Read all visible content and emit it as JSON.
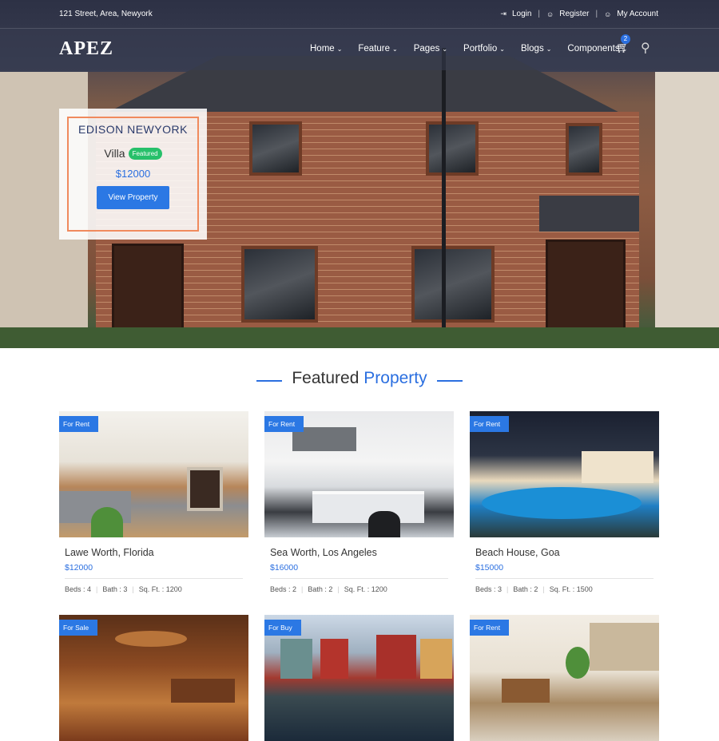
{
  "topbar": {
    "address": "121 Street, Area, Newyork",
    "login": "Login",
    "register": "Register",
    "account": "My Account"
  },
  "brand": {
    "logo": "APEZ"
  },
  "nav": {
    "items": [
      "Home",
      "Feature",
      "Pages",
      "Portfolio",
      "Blogs",
      "Components"
    ],
    "cart_count": "2"
  },
  "hero_card": {
    "title": "EDISON NEWYORK",
    "type": "Villa",
    "badge": "Featured",
    "price": "$12000",
    "button": "View Property"
  },
  "section": {
    "title_a": "Featured",
    "title_b": "Property"
  },
  "properties": [
    {
      "tag": "For Rent",
      "name": "Lawe Worth, Florida",
      "price": "$12000",
      "beds": "Beds : 4",
      "baths": "Bath : 3",
      "sqft": "Sq. Ft. : 1200"
    },
    {
      "tag": "For Rent",
      "name": "Sea Worth, Los Angeles",
      "price": "$16000",
      "beds": "Beds : 2",
      "baths": "Bath : 2",
      "sqft": "Sq. Ft. : 1200"
    },
    {
      "tag": "For Rent",
      "name": "Beach House, Goa",
      "price": "$15000",
      "beds": "Beds : 3",
      "baths": "Bath : 2",
      "sqft": "Sq. Ft. : 1500"
    },
    {
      "tag": "For Sale"
    },
    {
      "tag": "For Buy"
    },
    {
      "tag": "For Rent"
    }
  ],
  "colors": {
    "accent": "#2b6fe0",
    "featured": "#27c06a",
    "card_border": "#f08a5d"
  },
  "icons": {
    "login": "login-icon",
    "register": "user-icon",
    "account": "user-icon",
    "cart": "cart-icon",
    "search": "search-icon"
  }
}
